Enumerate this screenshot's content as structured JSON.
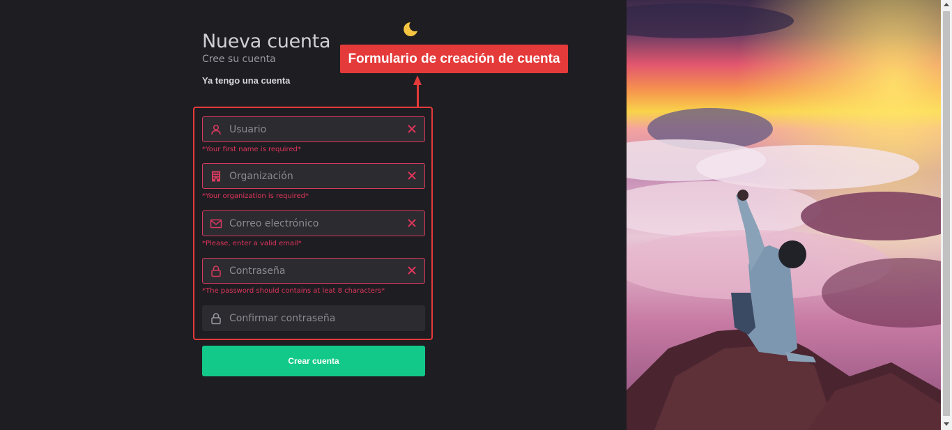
{
  "header": {
    "title": "Nueva cuenta",
    "subtitle": "Cree su cuenta",
    "login_link": "Ya tengo una cuenta"
  },
  "annotation": {
    "label": "Formulario de creación de cuenta"
  },
  "form": {
    "fields": [
      {
        "placeholder": "Usuario",
        "value": "",
        "icon": "user-icon",
        "error": "*Your first name is required*"
      },
      {
        "placeholder": "Organización",
        "value": "",
        "icon": "building-icon",
        "error": "*Your organization is required*"
      },
      {
        "placeholder": "Correo electrónico",
        "value": "",
        "icon": "mail-icon",
        "error": "*Please, enter a valid email*"
      },
      {
        "placeholder": "Contraseña",
        "value": "",
        "icon": "lock-icon",
        "error": "*The password should contains at leat 8 characters*"
      },
      {
        "placeholder": "Confirmar contraseña",
        "value": "",
        "icon": "lock-icon"
      }
    ],
    "submit_label": "Crear cuenta"
  },
  "colors": {
    "background": "#1e1d22",
    "error": "#e0355b",
    "accent": "#12c98a",
    "annotation": "#e53a3a",
    "moon": "#f5c542"
  }
}
